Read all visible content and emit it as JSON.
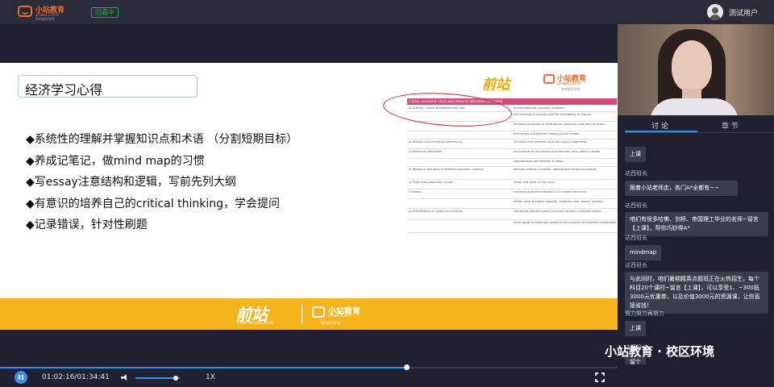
{
  "header": {
    "logo_title": "小站教育",
    "logo_domain": "zhan.com",
    "logo_slogan": "你的留学学伴",
    "replay_badge": "回看中",
    "user_name": "测试用户"
  },
  "slide": {
    "title": "经济学习心得",
    "bullets": [
      "◆系统性的理解并掌握知识点和术语 （分割短期目标）",
      "◆养成记笔记，做mind map的习惯",
      "◆写essay注意结构和逻辑，写前先列大纲",
      "◆有意识的培养自己的critical thinking，学会提问",
      "◆记录错误，针对性刷题"
    ],
    "brand_name": "前站",
    "brand_subtitle": "FRONTIER EDUCATION",
    "table": {
      "header": "1   Basic economic ideas and resource allocation (AS Level)",
      "rows": [
        {
          "topic": "a)  Scarcity, choice and opportunity cost",
          "content": "the fundamental economic problem"
        },
        {
          "topic": "",
          "content": "the meaning of scarcity and the inevitability of choices"
        },
        {
          "topic": "",
          "content": "the basic questions of what will be produced, how and for whom"
        },
        {
          "topic": "",
          "content": "the margin and decision making at the margin"
        },
        {
          "topic": "b)  Positive and normative statements",
          "content": "the distinction between facts and value judgements"
        },
        {
          "topic": "c)  Factors of production",
          "content": "the rewards to the factors of production: land, labour, capital"
        },
        {
          "topic": "",
          "content": "specialisation and division of labour"
        },
        {
          "topic": "d)  Resource allocation in different economic systems",
          "content": "decision making in market, planned and mixed economies"
        },
        {
          "topic": "e)  Production possibility curves",
          "content": "shape and shifts of the curve"
        },
        {
          "topic": "f)  Money",
          "content": "functions and characteristics in a modern economy"
        },
        {
          "topic": "",
          "content": "barter, cash and bank deposits, cheques, near money, liquidity"
        },
        {
          "topic": "g)  Classification of goods and services",
          "content": "free goods, private goods (economic goods) and public goods"
        },
        {
          "topic": "",
          "content": "merit goods and demerit goods as the outcome of imperfect information"
        }
      ]
    }
  },
  "watermark": "小站教育 · 校区环境",
  "panel": {
    "tab_discussion": "讨 论",
    "tab_chapter": "章 节",
    "messages": [
      {
        "sender": "",
        "text": "上课"
      },
      {
        "sender": "达西班长",
        "text": "跟着小站老师走，各门A*全都有~~"
      },
      {
        "sender": "达西班长",
        "text": "咱们有很多哈佛、剑桥、帝国理工毕业的名师~留言【上课】，帮你巧妙得A*"
      },
      {
        "sender": "达西班长",
        "text": "mindmap"
      },
      {
        "sender": "达西班长",
        "text": "与此同时，咱们暑期精英点题班正在火热招生，每个科目20个课时~留言【上课】，可以享受1、~300抵3000元优惠券，以及价值3000元的资源课，让你直接省钱！"
      },
      {
        "sender": "努力努力再努力",
        "text": "上课"
      },
      {
        "sender": "达西班长",
        "text": "留个"
      }
    ]
  },
  "controls": {
    "time": "01:02:16/01:34:41",
    "progress": 0.6577,
    "volume": 0.9,
    "speed": "1X"
  }
}
